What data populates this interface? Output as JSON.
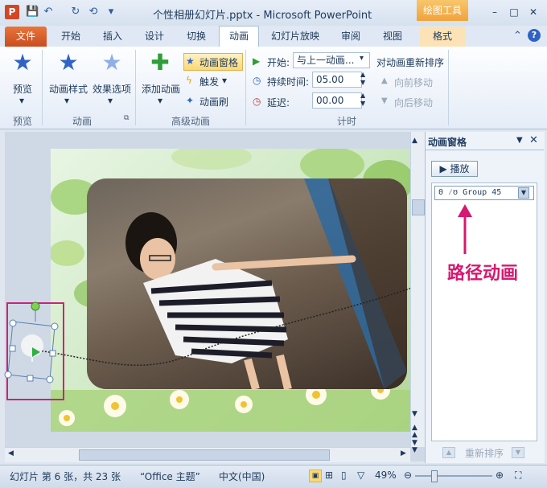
{
  "window": {
    "app_icon": "P",
    "title": "个性相册幻灯片.pptx - Microsoft PowerPoint",
    "context_tab_title": "绘图工具",
    "qat_icons": [
      "save-icon",
      "undo-icon",
      "redo-icon",
      "repeat-icon",
      "qat-dropdown-icon"
    ],
    "controls": {
      "minimize": "–",
      "maximize": "□",
      "close": "✕"
    }
  },
  "tabs": [
    {
      "label": "文件"
    },
    {
      "label": "开始"
    },
    {
      "label": "插入"
    },
    {
      "label": "设计"
    },
    {
      "label": "切换"
    },
    {
      "label": "动画"
    },
    {
      "label": "幻灯片放映"
    },
    {
      "label": "审阅"
    },
    {
      "label": "视图"
    },
    {
      "label": "格式"
    }
  ],
  "ribbon": {
    "preview": {
      "button": "预览",
      "group": "预览"
    },
    "animation": {
      "style_button": "动画样式",
      "effect_button": "效果选项",
      "group": "动画"
    },
    "advanced": {
      "add_button": "添加动画",
      "pane_button": "动画窗格",
      "trigger_button": "触发",
      "painter_button": "动画刷",
      "group": "高级动画"
    },
    "timing": {
      "start_label": "开始:",
      "start_value": "与上一动画...",
      "duration_label": "持续时间:",
      "duration_value": "05.00",
      "delay_label": "延迟:",
      "delay_value": "00.00",
      "reorder_title": "对动画重新排序",
      "move_earlier": "向前移动",
      "move_later": "向后移动",
      "group": "计时"
    }
  },
  "animation_pane": {
    "title": "动画窗格",
    "play_button": "播放",
    "item": "0 ⁄ʊ Group 45",
    "reorder_label": "重新排序",
    "annotation": "路径动画"
  },
  "status": {
    "slide_info": "幻灯片 第 6 张，共 23 张",
    "theme": "“Office 主题”",
    "language": "中文(中国)",
    "zoom": "49%"
  },
  "colors": {
    "accent": "#d6186f",
    "file_tab": "#d24726",
    "context_tab": "#f1a23a"
  }
}
